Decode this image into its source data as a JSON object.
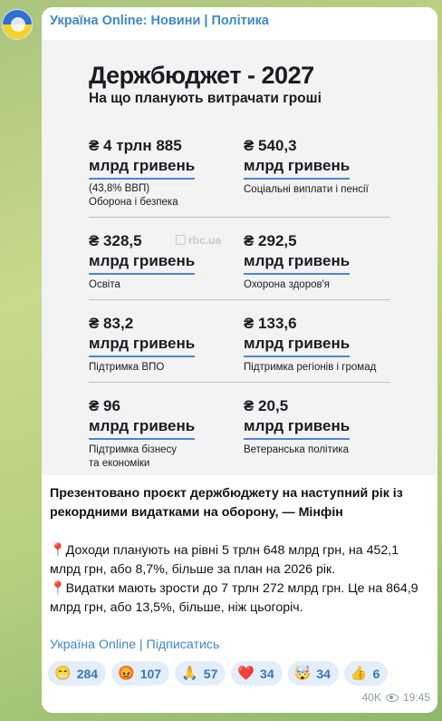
{
  "channel": {
    "title": "Україна Online: Новини | Політика"
  },
  "card": {
    "title": "Держбюджет - 2027",
    "subtitle": "На що планують витрачати гроші",
    "watermark": "rbc.ua",
    "items": [
      {
        "amount": "₴ 4 трлн 885",
        "unit": "млрд гривень",
        "note": "(43,8% ВВП)",
        "category": "Оборона і безпека"
      },
      {
        "amount": "₴ 540,3",
        "unit": "млрд гривень",
        "category": "Соціальні виплати і пенсії"
      },
      {
        "amount": "₴ 328,5",
        "unit": "млрд гривень",
        "category": "Освіта"
      },
      {
        "amount": "₴ 292,5",
        "unit": "млрд гривень",
        "category": "Охорона здоров'я"
      },
      {
        "amount": "₴ 83,2",
        "unit": "млрд гривень",
        "category": "Підтримка ВПО"
      },
      {
        "amount": "₴ 133,6",
        "unit": "млрд гривень",
        "category": "Підтримка регіонів і громад"
      },
      {
        "amount": "₴ 96",
        "unit": "млрд гривень",
        "category": "Підтримка бізнесу\nта економіки"
      },
      {
        "amount": "₴ 20,5",
        "unit": "млрд гривень",
        "category": "Ветеранська політика"
      }
    ]
  },
  "message": {
    "lead": "Презентовано проєкт держбюджету на наступний рік із рекордними видатками на оборону, — Мінфін",
    "point1": "Доходи планують на рівні 5 трлн 648 млрд грн, на 452,1 млрд грн, або 8,7%, більше за план на 2026 рік.",
    "point2": "Видатки мають зрости до 7 трлн 272 млрд грн. Це на 864,9 млрд грн, або 13,5%, більше, ніж цьогоріч.",
    "pin_glyph": "📍",
    "subscribe_link": "Україна Online | Підписатись"
  },
  "reactions": [
    {
      "emoji": "😁",
      "count": "284"
    },
    {
      "emoji": "😡",
      "count": "107"
    },
    {
      "emoji": "🙏",
      "count": "57"
    },
    {
      "emoji": "❤️",
      "count": "34"
    },
    {
      "emoji": "🤯",
      "count": "34"
    },
    {
      "emoji": "👍",
      "count": "6"
    }
  ],
  "meta": {
    "views": "40K",
    "time": "19:45"
  }
}
